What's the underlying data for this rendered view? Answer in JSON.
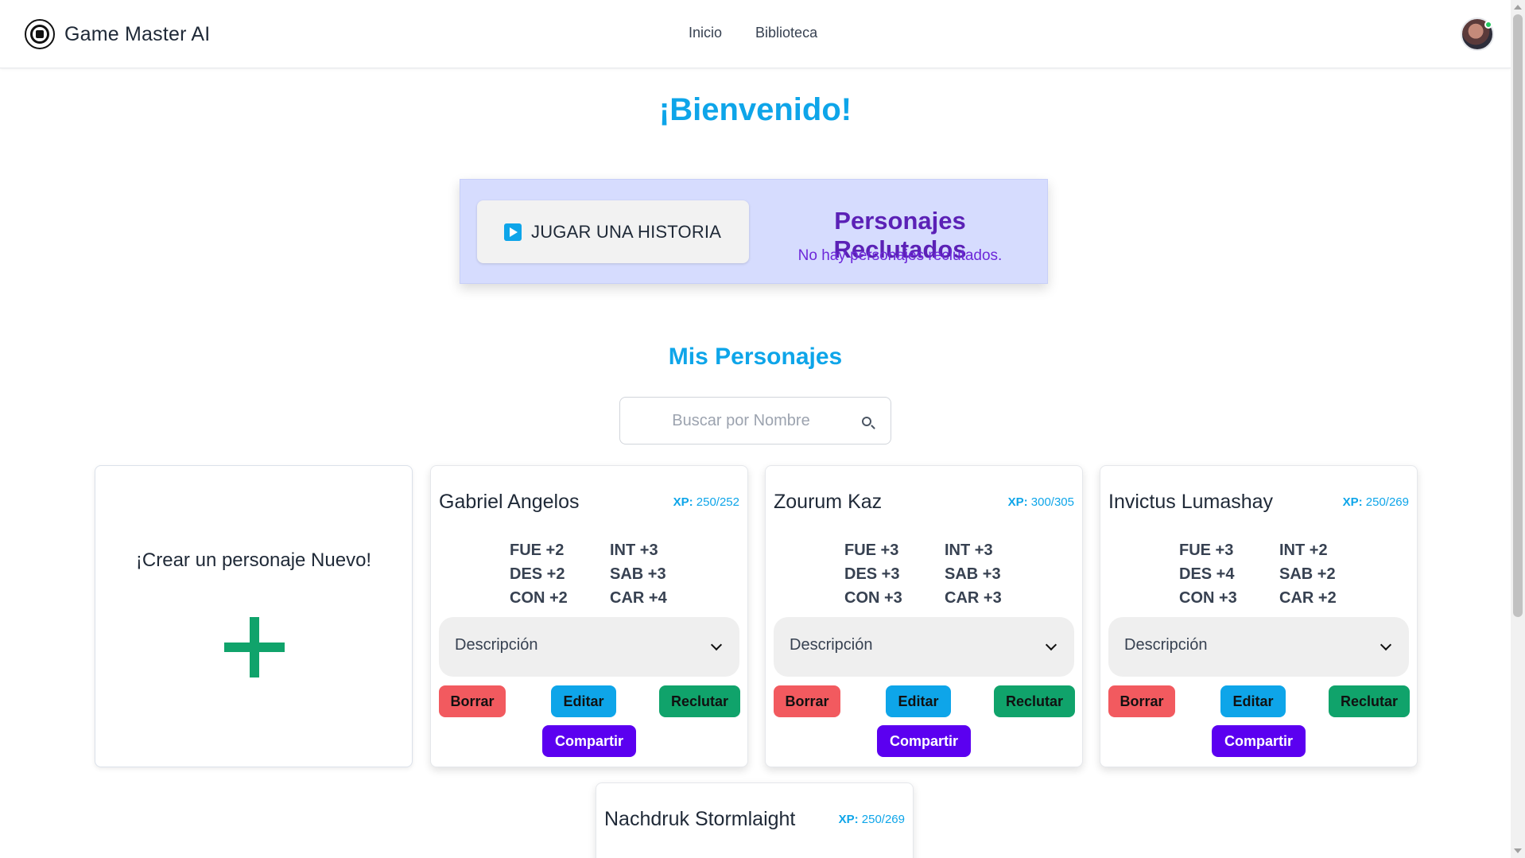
{
  "app": {
    "title": "Game Master AI"
  },
  "nav": {
    "links": [
      "Inicio",
      "Biblioteca"
    ]
  },
  "welcome": "¡Bienvenido!",
  "hero": {
    "play_label": "JUGAR UNA HISTORIA",
    "recruited_title": "Personajes Reclutados",
    "recruited_empty": "No hay personajes reclutados."
  },
  "section": {
    "title": "Mis Personajes",
    "search_placeholder": "Buscar por Nombre"
  },
  "create_card": {
    "label": "¡Crear un personaje Nuevo!"
  },
  "labels": {
    "xp": "XP:",
    "description": "Descripción",
    "delete": "Borrar",
    "edit": "Editar",
    "recruit": "Reclutar",
    "share": "Compartir"
  },
  "characters": [
    {
      "name": "Gabriel Angelos",
      "xp": "250/252",
      "stats": [
        "FUE +2",
        "INT +3",
        "DES +2",
        "SAB +3",
        "CON +2",
        "CAR +4"
      ]
    },
    {
      "name": "Zourum Kaz",
      "xp": "300/305",
      "stats": [
        "FUE +3",
        "INT +3",
        "DES +3",
        "SAB +3",
        "CON +3",
        "CAR +3"
      ]
    },
    {
      "name": "Invictus Lumashay",
      "xp": "250/269",
      "stats": [
        "FUE +3",
        "INT +2",
        "DES +4",
        "SAB +2",
        "CON +3",
        "CAR +2"
      ]
    },
    {
      "name": "Nachdruk Stormlaight",
      "xp": "250/269"
    }
  ],
  "colors": {
    "accent": "#0ea5e9",
    "purple": "#5b21b6",
    "hero_bg": "#d6dcfe",
    "danger": "#f25a5f",
    "success": "#10a36b",
    "share": "#5b00f0"
  }
}
